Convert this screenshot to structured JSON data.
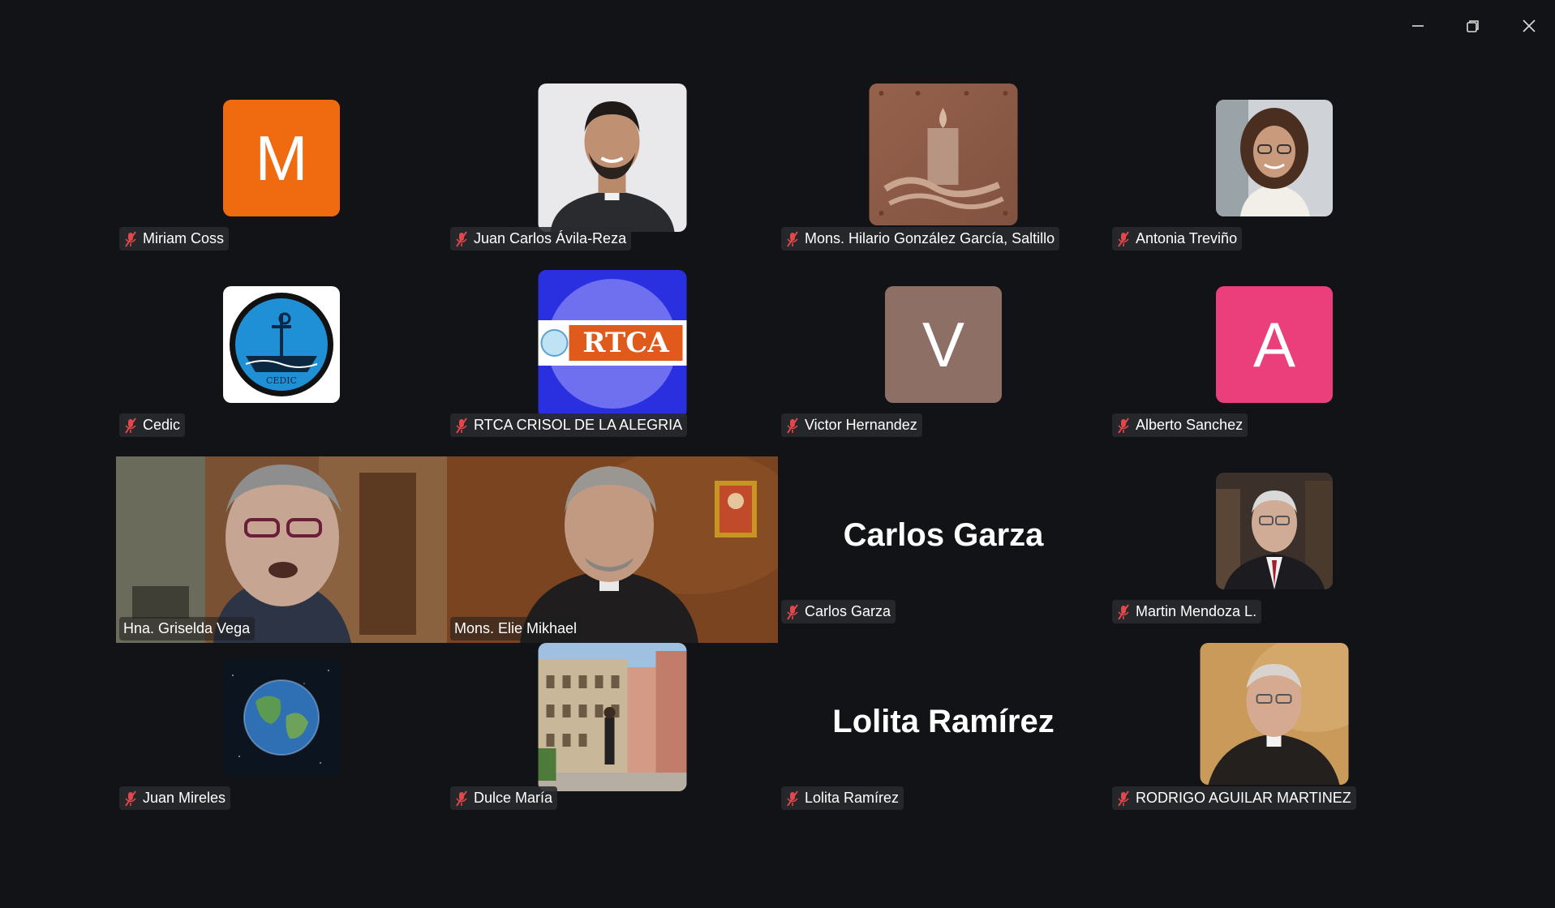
{
  "window": {
    "controls": [
      "minimize",
      "restore",
      "close"
    ]
  },
  "colors": {
    "background": "#111317",
    "active_speaker": "#22d07a",
    "muted_icon": "#e2474b"
  },
  "participants": [
    {
      "name": "Miriam Coss",
      "kind": "initial",
      "initial": "M",
      "color": "#f06a0f",
      "muted": true
    },
    {
      "name": "Juan Carlos Ávila-Reza",
      "kind": "photo",
      "muted": true
    },
    {
      "name": "Mons. Hilario González García, Saltillo",
      "kind": "photo",
      "muted": true
    },
    {
      "name": "Antonia Treviño",
      "kind": "photo",
      "muted": true
    },
    {
      "name": "Cedic",
      "kind": "logo",
      "logo_text": "CEDIC",
      "muted": true
    },
    {
      "name": "RTCA CRISOL DE LA ALEGRIA",
      "kind": "logo",
      "logo_text": "RTCA",
      "muted": true
    },
    {
      "name": "Victor Hernandez",
      "kind": "initial",
      "initial": "V",
      "color": "#8e6f65",
      "muted": true
    },
    {
      "name": "Alberto Sanchez",
      "kind": "initial",
      "initial": "A",
      "color": "#ea3f7b",
      "muted": true
    },
    {
      "name": "Hna. Griselda Vega",
      "kind": "video",
      "muted": false,
      "active": true
    },
    {
      "name": "Mons. Elie Mikhael",
      "kind": "video",
      "muted": false
    },
    {
      "name": "Carlos Garza",
      "kind": "name-only",
      "muted": true
    },
    {
      "name": "Martin Mendoza L.",
      "kind": "photo",
      "muted": true
    },
    {
      "name": "Juan Mireles",
      "kind": "photo",
      "muted": true
    },
    {
      "name": "Dulce María",
      "kind": "photo",
      "muted": true
    },
    {
      "name": "Lolita Ramírez",
      "kind": "name-only",
      "muted": true
    },
    {
      "name": "RODRIGO AGUILAR MARTINEZ",
      "kind": "photo",
      "muted": true
    }
  ]
}
